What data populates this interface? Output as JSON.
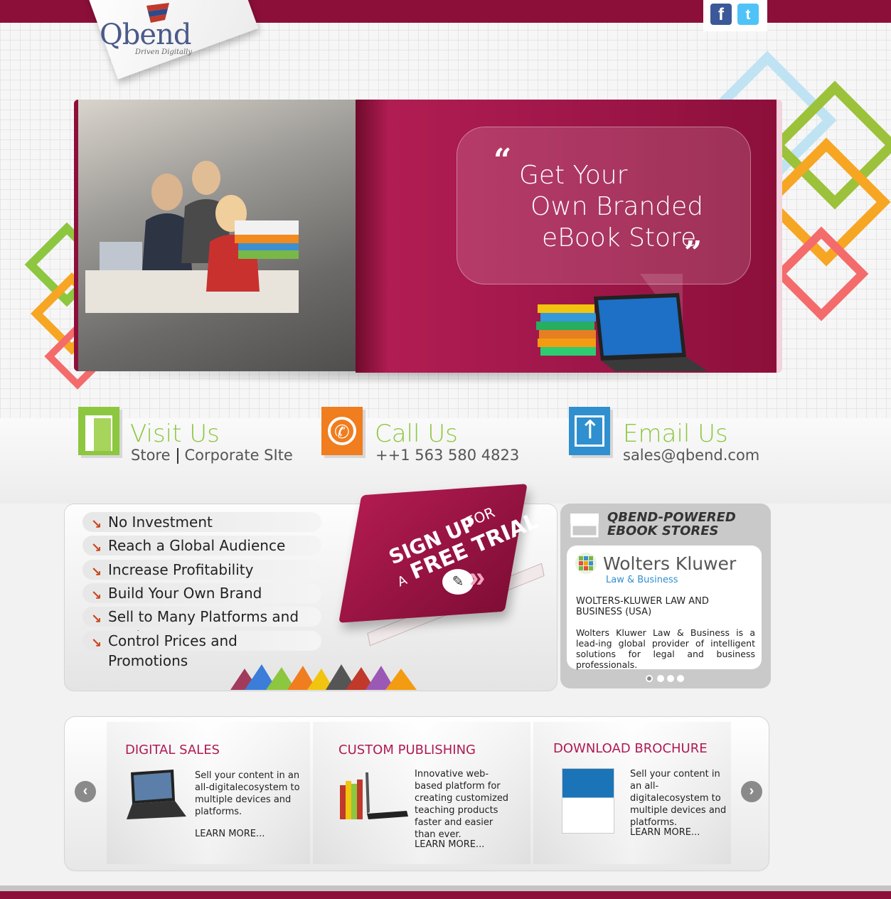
{
  "header": {
    "logo_text": "Qbend",
    "logo_tagline": "Driven Digitally",
    "social": {
      "facebook_icon": "facebook-icon",
      "twitter_icon": "twitter-icon"
    }
  },
  "hero": {
    "lines": [
      "Get Your",
      "Own Branded",
      "eBook Store"
    ],
    "open_quote": "“",
    "close_quote": "”"
  },
  "contact": {
    "visit": {
      "title": "Visit Us",
      "link1": "Store",
      "link2": "Corporate SIte"
    },
    "call": {
      "title": "Call Us",
      "phone": "++1 563 580 4823"
    },
    "email": {
      "title": "Email Us",
      "address": "sales@qbend.com"
    }
  },
  "features": {
    "items": [
      "No Investment",
      "Reach a Global Audience",
      "Increase Profitability",
      "Build Your Own Brand",
      "Sell to Many Platforms and Devices",
      "Control Prices and Promotions"
    ],
    "signup": {
      "line1": "SIGN UP",
      "for": "FOR",
      "line2_a": "A",
      "line2_b": "FREE TRIAL"
    }
  },
  "stores": {
    "title_line1": "QBEND-POWERED",
    "title_line2": "EBOOK STORES",
    "brand_name": "Wolters Kluwer",
    "brand_sub": "Law & Business",
    "caption": "WOLTERS-KLUWER LAW AND BUSINESS (USA)",
    "description": "Wolters Kluwer Law & Business is a lead-ing global provider of intelligent solutions for legal and business professionals.",
    "dots": 4,
    "active_dot": 0
  },
  "services": [
    {
      "title": "DIGITAL SALES",
      "text": "Sell your content in an all-digitalecosystem to multiple devices and platforms.",
      "link": "LEARN MORE..."
    },
    {
      "title": "CUSTOM PUBLISHING",
      "text": "Innovative web-based platform for creating customized teaching products faster and easier than ever.",
      "link": "LEARN MORE..."
    },
    {
      "title": "DOWNLOAD BROCHURE",
      "text": "Sell your content in an all-digitalecosystem to multiple devices and platforms.",
      "link": "LEARN MORE..."
    }
  ],
  "colors": {
    "brand": "#8c0f3a",
    "accent_green": "#8dc63f",
    "pink": "#b01a52"
  }
}
